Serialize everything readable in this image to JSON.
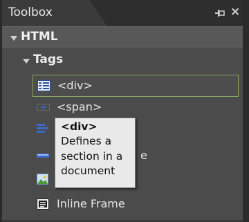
{
  "panel": {
    "tab_title": "Toolbox",
    "pin_icon": "pin-icon",
    "close_glyph": "×"
  },
  "groups": {
    "html_label": "HTML",
    "tags_label": "Tags"
  },
  "items": [
    {
      "label": "<div>",
      "icon": "div-tag-icon",
      "selected": true
    },
    {
      "label": "<span>",
      "icon": "span-tag-icon"
    },
    {
      "label": "",
      "icon": "blue-lines-icon"
    },
    {
      "label": "e",
      "icon": "horizontal-rule-icon"
    },
    {
      "label": "",
      "icon": "image-icon"
    },
    {
      "label": "Inline Frame",
      "icon": "iframe-icon"
    }
  ],
  "tooltip": {
    "title": "<div>",
    "body": "Defines a section in a document"
  },
  "colors": {
    "panel_bg": "#4b4b4b",
    "selected_border": "#8aa85c",
    "tooltip_bg": "#e9e9e9"
  }
}
